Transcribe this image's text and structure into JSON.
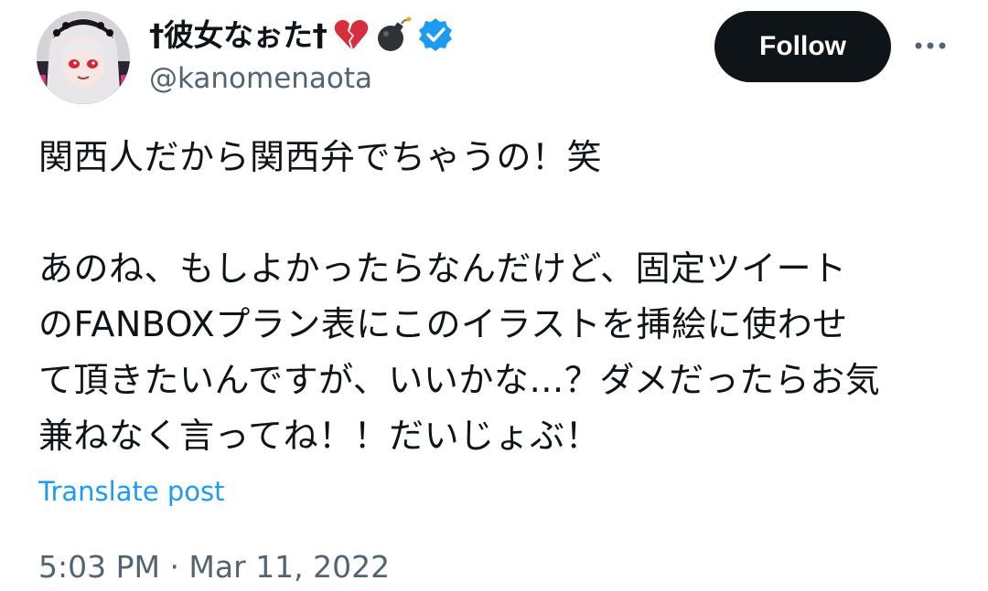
{
  "author": {
    "display_name": "†彼女なぉた†",
    "handle": "@kanomenaota",
    "badges": [
      "broken-heart-icon",
      "bomb-icon",
      "verified-badge-icon"
    ]
  },
  "actions": {
    "follow_label": "Follow",
    "more_icon": "more-dots-icon"
  },
  "post": {
    "lines": [
      "関西人だから関西弁でちゃうの！笑",
      "",
      "あのね、もしよかったらなんだけど、固定ツイート",
      "のFANBOXプラン表にこのイラストを挿絵に使わせ",
      "て頂きたいんですが、いいかな…？ダメだったらお気",
      "兼ねなく言ってね！！だいじょぶ！"
    ],
    "translate_label": "Translate post",
    "timestamp": "5:03 PM · Mar 11, 2022"
  },
  "colors": {
    "text": "#0f1419",
    "secondary": "#536471",
    "link": "#1d9bf0",
    "verified": "#1d9bf0",
    "follow_bg": "#0f1419"
  }
}
